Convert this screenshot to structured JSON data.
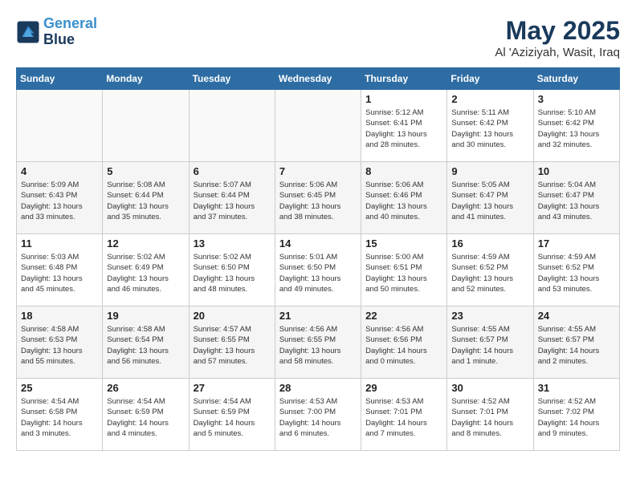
{
  "header": {
    "logo_line1": "General",
    "logo_line2": "Blue",
    "month": "May 2025",
    "location": "Al 'Aziziyah, Wasit, Iraq"
  },
  "weekdays": [
    "Sunday",
    "Monday",
    "Tuesday",
    "Wednesday",
    "Thursday",
    "Friday",
    "Saturday"
  ],
  "weeks": [
    [
      {
        "day": "",
        "info": ""
      },
      {
        "day": "",
        "info": ""
      },
      {
        "day": "",
        "info": ""
      },
      {
        "day": "",
        "info": ""
      },
      {
        "day": "1",
        "info": "Sunrise: 5:12 AM\nSunset: 6:41 PM\nDaylight: 13 hours\nand 28 minutes."
      },
      {
        "day": "2",
        "info": "Sunrise: 5:11 AM\nSunset: 6:42 PM\nDaylight: 13 hours\nand 30 minutes."
      },
      {
        "day": "3",
        "info": "Sunrise: 5:10 AM\nSunset: 6:42 PM\nDaylight: 13 hours\nand 32 minutes."
      }
    ],
    [
      {
        "day": "4",
        "info": "Sunrise: 5:09 AM\nSunset: 6:43 PM\nDaylight: 13 hours\nand 33 minutes."
      },
      {
        "day": "5",
        "info": "Sunrise: 5:08 AM\nSunset: 6:44 PM\nDaylight: 13 hours\nand 35 minutes."
      },
      {
        "day": "6",
        "info": "Sunrise: 5:07 AM\nSunset: 6:44 PM\nDaylight: 13 hours\nand 37 minutes."
      },
      {
        "day": "7",
        "info": "Sunrise: 5:06 AM\nSunset: 6:45 PM\nDaylight: 13 hours\nand 38 minutes."
      },
      {
        "day": "8",
        "info": "Sunrise: 5:06 AM\nSunset: 6:46 PM\nDaylight: 13 hours\nand 40 minutes."
      },
      {
        "day": "9",
        "info": "Sunrise: 5:05 AM\nSunset: 6:47 PM\nDaylight: 13 hours\nand 41 minutes."
      },
      {
        "day": "10",
        "info": "Sunrise: 5:04 AM\nSunset: 6:47 PM\nDaylight: 13 hours\nand 43 minutes."
      }
    ],
    [
      {
        "day": "11",
        "info": "Sunrise: 5:03 AM\nSunset: 6:48 PM\nDaylight: 13 hours\nand 45 minutes."
      },
      {
        "day": "12",
        "info": "Sunrise: 5:02 AM\nSunset: 6:49 PM\nDaylight: 13 hours\nand 46 minutes."
      },
      {
        "day": "13",
        "info": "Sunrise: 5:02 AM\nSunset: 6:50 PM\nDaylight: 13 hours\nand 48 minutes."
      },
      {
        "day": "14",
        "info": "Sunrise: 5:01 AM\nSunset: 6:50 PM\nDaylight: 13 hours\nand 49 minutes."
      },
      {
        "day": "15",
        "info": "Sunrise: 5:00 AM\nSunset: 6:51 PM\nDaylight: 13 hours\nand 50 minutes."
      },
      {
        "day": "16",
        "info": "Sunrise: 4:59 AM\nSunset: 6:52 PM\nDaylight: 13 hours\nand 52 minutes."
      },
      {
        "day": "17",
        "info": "Sunrise: 4:59 AM\nSunset: 6:52 PM\nDaylight: 13 hours\nand 53 minutes."
      }
    ],
    [
      {
        "day": "18",
        "info": "Sunrise: 4:58 AM\nSunset: 6:53 PM\nDaylight: 13 hours\nand 55 minutes."
      },
      {
        "day": "19",
        "info": "Sunrise: 4:58 AM\nSunset: 6:54 PM\nDaylight: 13 hours\nand 56 minutes."
      },
      {
        "day": "20",
        "info": "Sunrise: 4:57 AM\nSunset: 6:55 PM\nDaylight: 13 hours\nand 57 minutes."
      },
      {
        "day": "21",
        "info": "Sunrise: 4:56 AM\nSunset: 6:55 PM\nDaylight: 13 hours\nand 58 minutes."
      },
      {
        "day": "22",
        "info": "Sunrise: 4:56 AM\nSunset: 6:56 PM\nDaylight: 14 hours\nand 0 minutes."
      },
      {
        "day": "23",
        "info": "Sunrise: 4:55 AM\nSunset: 6:57 PM\nDaylight: 14 hours\nand 1 minute."
      },
      {
        "day": "24",
        "info": "Sunrise: 4:55 AM\nSunset: 6:57 PM\nDaylight: 14 hours\nand 2 minutes."
      }
    ],
    [
      {
        "day": "25",
        "info": "Sunrise: 4:54 AM\nSunset: 6:58 PM\nDaylight: 14 hours\nand 3 minutes."
      },
      {
        "day": "26",
        "info": "Sunrise: 4:54 AM\nSunset: 6:59 PM\nDaylight: 14 hours\nand 4 minutes."
      },
      {
        "day": "27",
        "info": "Sunrise: 4:54 AM\nSunset: 6:59 PM\nDaylight: 14 hours\nand 5 minutes."
      },
      {
        "day": "28",
        "info": "Sunrise: 4:53 AM\nSunset: 7:00 PM\nDaylight: 14 hours\nand 6 minutes."
      },
      {
        "day": "29",
        "info": "Sunrise: 4:53 AM\nSunset: 7:01 PM\nDaylight: 14 hours\nand 7 minutes."
      },
      {
        "day": "30",
        "info": "Sunrise: 4:52 AM\nSunset: 7:01 PM\nDaylight: 14 hours\nand 8 minutes."
      },
      {
        "day": "31",
        "info": "Sunrise: 4:52 AM\nSunset: 7:02 PM\nDaylight: 14 hours\nand 9 minutes."
      }
    ]
  ]
}
